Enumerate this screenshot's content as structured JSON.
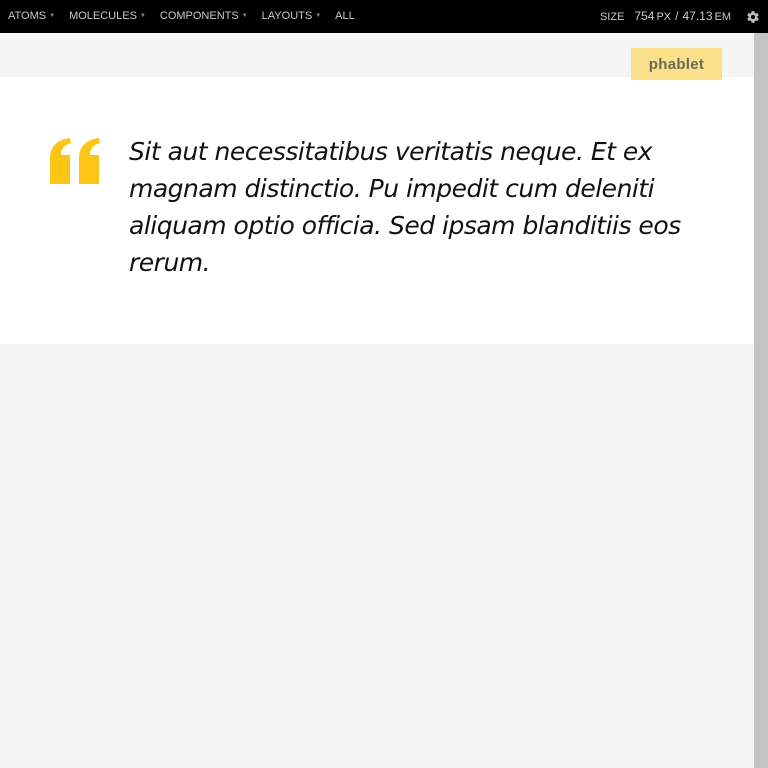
{
  "toolbar": {
    "nav": [
      {
        "label": "ATOMS",
        "caret": "▼"
      },
      {
        "label": "MOLECULES",
        "caret": "▼"
      },
      {
        "label": "COMPONENTS",
        "caret": "▼"
      },
      {
        "label": "LAYOUTS",
        "caret": "▼"
      },
      {
        "label": "ALL",
        "caret": ""
      }
    ],
    "size_label": "SIZE",
    "size_px_value": "754",
    "size_px_unit": "PX",
    "size_separator": "/",
    "size_em_value": "47.13",
    "size_em_unit": "EM",
    "settings_icon": "gear-icon"
  },
  "viewport": {
    "breakpoint_badge": "phablet",
    "quote": {
      "mark_icon": "open-quote-icon",
      "text": "Sit aut necessitatibus veritatis neque. Et ex magnam distinctio. Pu impedit cum deleniti aliquam optio officia. Sed ipsam blanditiis eos rerum."
    }
  },
  "colors": {
    "toolbar_bg": "#000000",
    "accent": "#fdc516",
    "badge_bg": "#fae08a",
    "page_bg": "#f5f5f5",
    "scrollbar": "#c4c4c4"
  }
}
